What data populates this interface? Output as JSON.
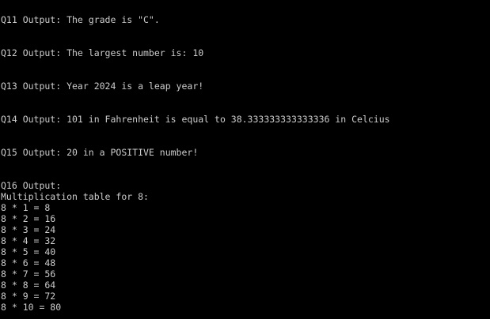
{
  "console": {
    "colors": {
      "background": "#000000",
      "text": "#cccccc"
    },
    "lines": [
      "Q11 Output: The grade is \"C\".",
      "Q12 Output: The largest number is: 10",
      "Q13 Output: Year 2024 is a leap year!",
      "Q14 Output: 101 in Fahrenheit is equal to 38.333333333333336 in Celcius",
      "Q15 Output: 20 in a POSITIVE number!",
      "Q16 Output:",
      "Multiplication table for 8:",
      "8 * 1 = 8",
      "8 * 2 = 16",
      "8 * 3 = 24",
      "8 * 4 = 32",
      "8 * 5 = 40",
      "8 * 6 = 48",
      "8 * 7 = 56",
      "8 * 8 = 64",
      "8 * 9 = 72",
      "8 * 10 = 80"
    ]
  }
}
